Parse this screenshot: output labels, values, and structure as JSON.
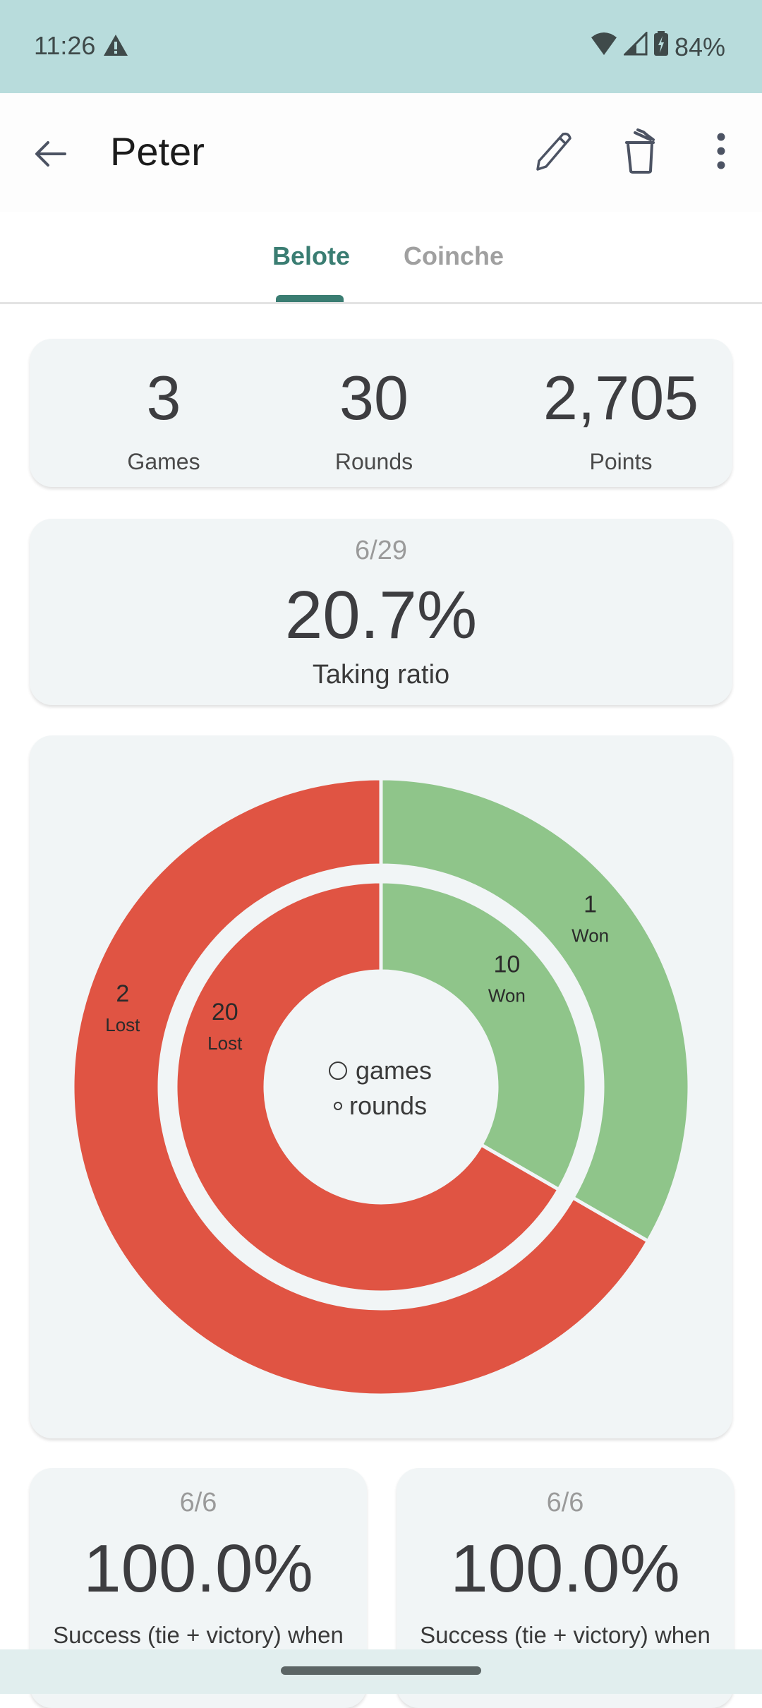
{
  "status_bar": {
    "time": "11:26",
    "battery": "84%",
    "icons": [
      "warning-icon",
      "wifi-icon",
      "signal-icon",
      "battery-charging-icon"
    ]
  },
  "app_bar": {
    "title": "Peter",
    "icons": [
      "back-arrow-icon",
      "edit-pencil-icon",
      "delete-trash-icon",
      "more-vert-icon"
    ]
  },
  "tabs": [
    {
      "label": "Belote",
      "active": true
    },
    {
      "label": "Coinche",
      "active": false
    }
  ],
  "summary": {
    "games": {
      "value": "3",
      "label": "Games"
    },
    "rounds": {
      "value": "30",
      "label": "Rounds"
    },
    "points": {
      "value": "2,705",
      "label": "Points"
    }
  },
  "taking_ratio": {
    "fraction": "6/29",
    "percent": "20.7%",
    "label": "Taking ratio"
  },
  "chart_data": {
    "type": "pie",
    "subtype": "nested-donut",
    "legend": [
      {
        "symbol": "large-circle",
        "label": "games"
      },
      {
        "symbol": "small-circle",
        "label": "rounds"
      }
    ],
    "series": [
      {
        "name": "games",
        "ring": "outer",
        "slices": [
          {
            "label": "Won",
            "value": 1,
            "color": "#8fc58a"
          },
          {
            "label": "Lost",
            "value": 2,
            "color": "#e05443"
          }
        ]
      },
      {
        "name": "rounds",
        "ring": "inner",
        "slices": [
          {
            "label": "Won",
            "value": 10,
            "color": "#8fc58a"
          },
          {
            "label": "Lost",
            "value": 20,
            "color": "#e05443"
          }
        ]
      }
    ],
    "legend_placement": "center"
  },
  "success_cards": [
    {
      "fraction": "6/6",
      "percent": "100.0%",
      "label": "Success (tie + victory) when Peter"
    },
    {
      "fraction": "6/6",
      "percent": "100.0%",
      "label": "Success (tie + victory) when Peter"
    }
  ],
  "colors": {
    "accent": "#3a7d72",
    "won": "#8fc58a",
    "lost": "#e05443",
    "card_bg": "#f1f5f6",
    "status_bar": "#b8dcdc"
  }
}
